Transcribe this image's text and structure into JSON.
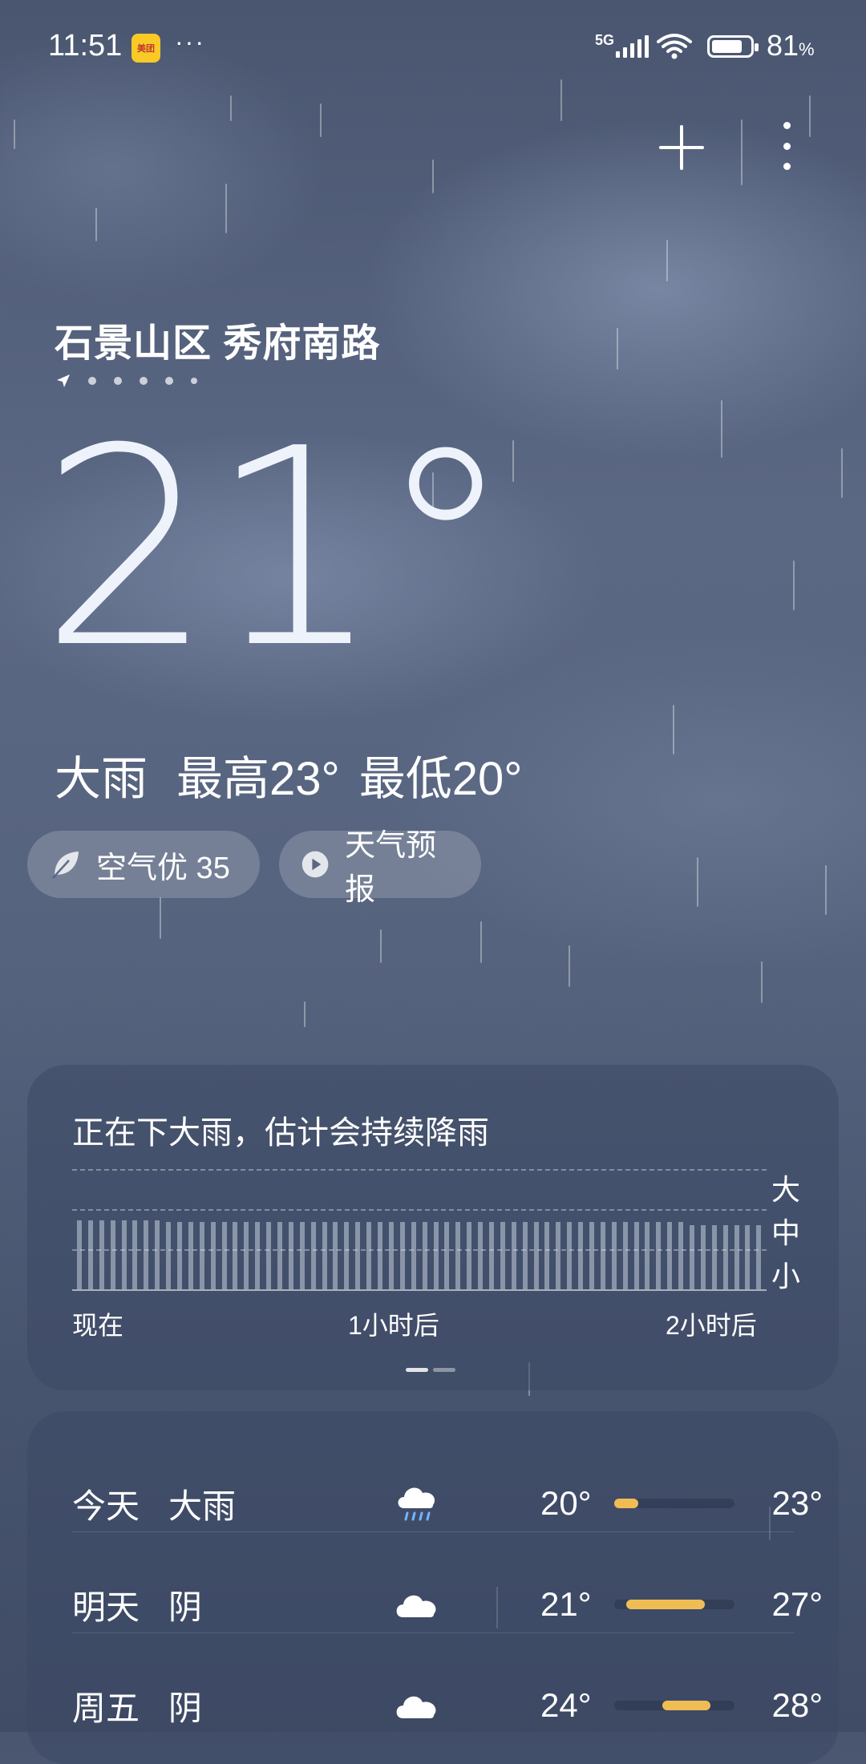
{
  "status_bar": {
    "time": "11:51",
    "app_badge": "美团",
    "more": "···",
    "network": "5G",
    "battery_percent": "81",
    "battery_symbol": "%",
    "battery_level": 0.81
  },
  "header": {
    "location": "石景山区 秀府南路",
    "pager_pages": 5
  },
  "current": {
    "temperature": "21°",
    "condition": "大雨",
    "high": "最高23°",
    "low": "最低20°"
  },
  "chips": {
    "air_quality": "空气优 35",
    "forecast": "天气预报"
  },
  "precipitation": {
    "title": "正在下大雨，估计会持续降雨",
    "levels": [
      "大",
      "中",
      "小"
    ],
    "x_labels": [
      "现在",
      "1小时后",
      "2小时后"
    ]
  },
  "daily": [
    {
      "day": "今天",
      "condition": "大雨",
      "icon": "heavy-rain-icon",
      "low": "20°",
      "high": "23°",
      "range": [
        0.0,
        0.2
      ]
    },
    {
      "day": "明天",
      "condition": "阴",
      "icon": "cloud-icon",
      "low": "21°",
      "high": "27°",
      "range": [
        0.1,
        0.75
      ]
    },
    {
      "day": "周五",
      "condition": "阴",
      "icon": "cloud-icon",
      "low": "24°",
      "high": "28°",
      "range": [
        0.4,
        0.8
      ]
    }
  ],
  "colors": {
    "range_bar": "#f0bd55",
    "badge_bg": "#f9c928"
  }
}
